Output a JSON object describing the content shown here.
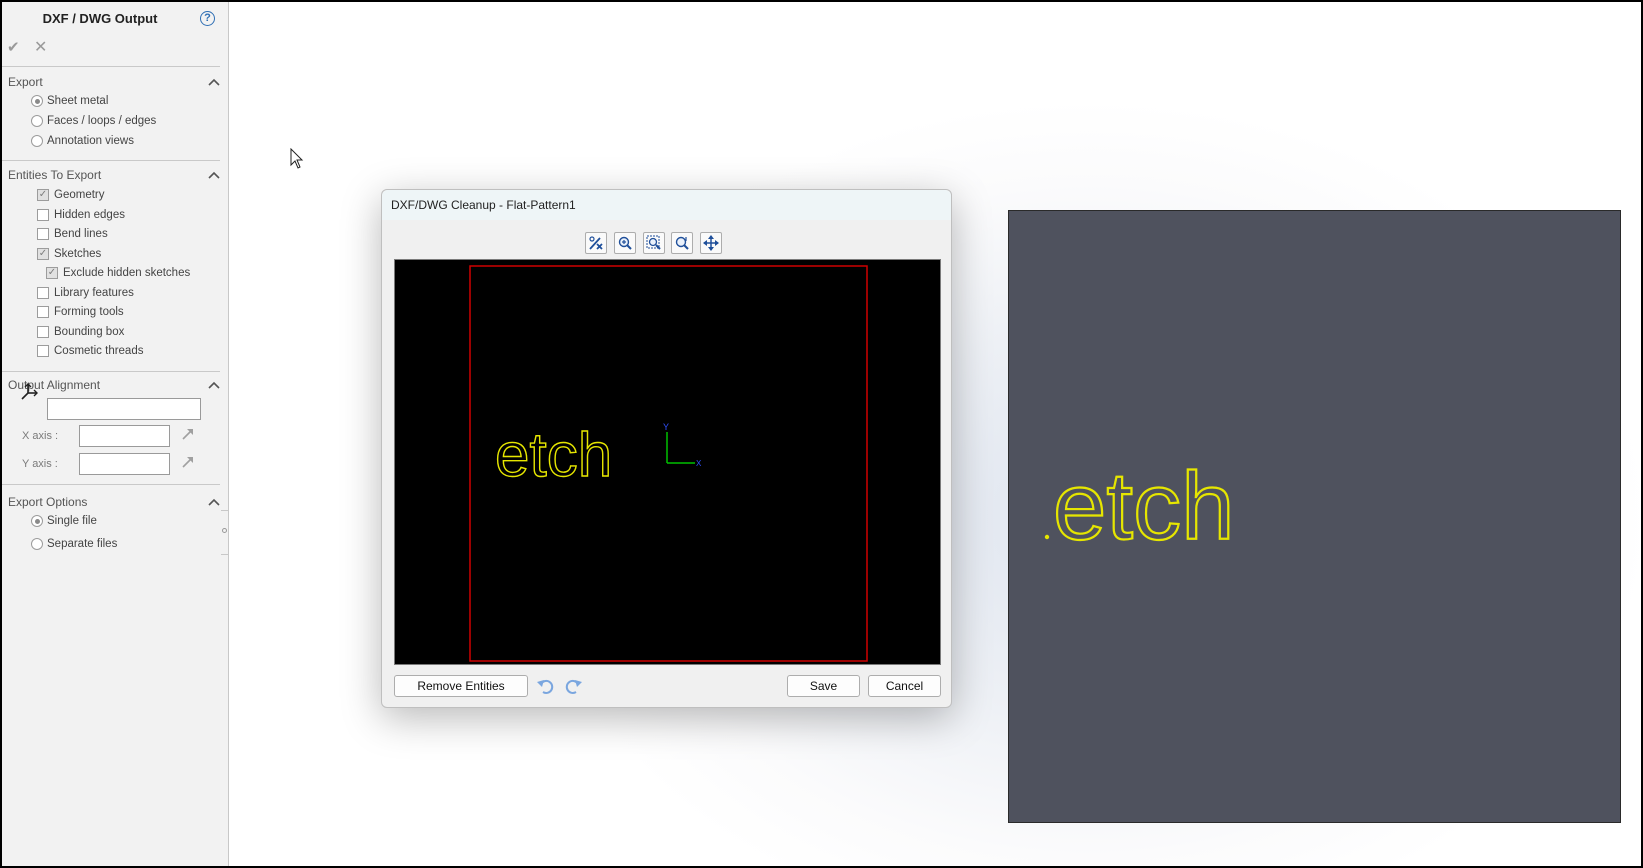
{
  "panel": {
    "title": "DXF / DWG Output",
    "help_icon": "?",
    "sections": {
      "export": {
        "label": "Export",
        "options": [
          "Sheet metal",
          "Faces / loops / edges",
          "Annotation views"
        ],
        "selected": "Sheet metal"
      },
      "entities": {
        "label": "Entities To Export",
        "items": {
          "geometry": "Geometry",
          "hidden_edges": "Hidden edges",
          "bend_lines": "Bend lines",
          "sketches": "Sketches",
          "exclude_hidden_sketches": "Exclude hidden sketches",
          "library_features": "Library features",
          "forming_tools": "Forming tools",
          "bounding_box": "Bounding box",
          "cosmetic_threads": "Cosmetic threads"
        },
        "checked": [
          "Geometry",
          "Sketches",
          "Exclude hidden sketches"
        ]
      },
      "alignment": {
        "label": "Output Alignment",
        "origin_value": "",
        "x_axis_label": "X axis :",
        "x_axis_value": "",
        "y_axis_label": "Y axis :",
        "y_axis_value": ""
      },
      "export_options": {
        "label": "Export Options",
        "single_file": "Single file",
        "separate_files": "Separate files",
        "selected": "Single file"
      }
    }
  },
  "dialog": {
    "title": "DXF/DWG Cleanup - Flat-Pattern1",
    "toolbar": [
      "remove-entity-icon",
      "zoom-in-icon",
      "zoom-to-fit-icon",
      "zoom-area-icon",
      "pan-icon"
    ],
    "preview": {
      "text": "etch",
      "text_color": "#e6e600",
      "border_color": "#d00000",
      "axis_y_label": "Y",
      "axis_x_label": "X"
    },
    "buttons": {
      "remove_entities": "Remove Entities",
      "save": "Save",
      "cancel": "Cancel"
    }
  },
  "model": {
    "text": ".etch",
    "plate_color": "#4f525e",
    "text_color": "#e6e600"
  },
  "colors": {
    "accent": "#2f6fb4",
    "panel_bg": "#f2f2f2"
  }
}
